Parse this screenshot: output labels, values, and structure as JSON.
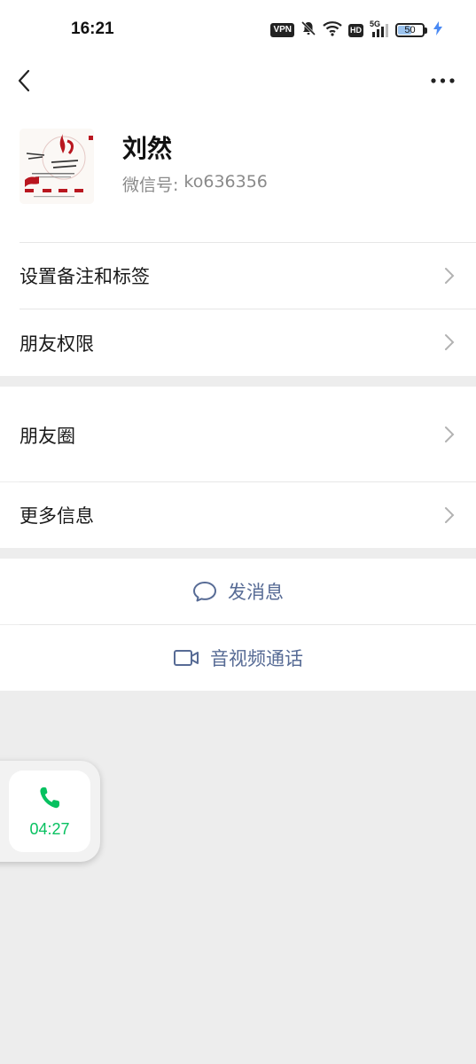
{
  "status_bar": {
    "time": "16:21",
    "vpn": "VPN",
    "hd": "HD",
    "network": "5G",
    "battery": "50",
    "battery_level": 0.5
  },
  "nav": {
    "back_icon": "chevron-left-icon",
    "more_icon": "more-horizontal-icon"
  },
  "profile": {
    "name": "刘然",
    "wechat_id_label": "微信号:",
    "wechat_id": "ko636356"
  },
  "menu": {
    "set_remark": "设置备注和标签",
    "friend_permissions": "朋友权限",
    "moments": "朋友圈",
    "more_info": "更多信息"
  },
  "actions": {
    "send_message": "发消息",
    "video_call": "音视频通话"
  },
  "floating_call": {
    "duration": "04:27",
    "icon": "phone-icon"
  },
  "colors": {
    "link": "#576b95",
    "call_green": "#07c160",
    "background": "#ededed"
  }
}
